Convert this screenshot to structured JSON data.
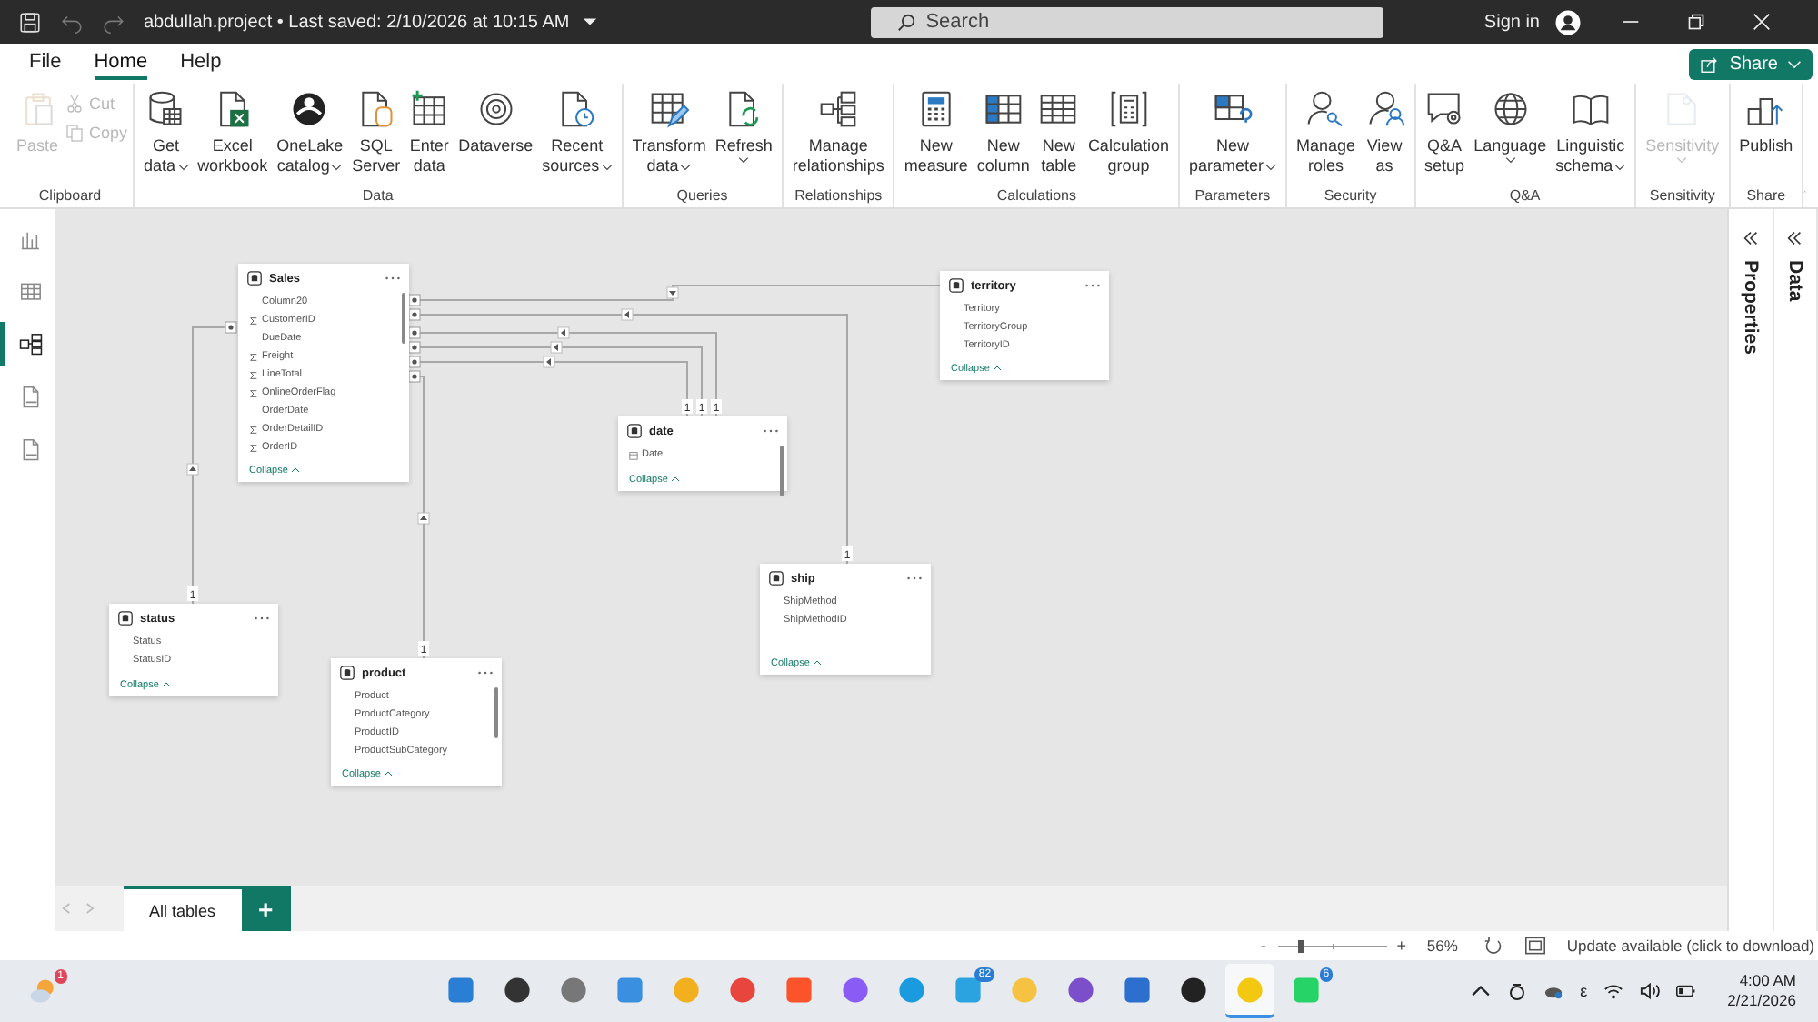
{
  "title_bar": {
    "title": "abdullah.project • Last saved: 2/10/2026 at 10:15 AM",
    "search": {
      "placeholder": "Search"
    },
    "sign_in": "Sign in"
  },
  "menu_tabs": [
    {
      "label": "File",
      "selected": false
    },
    {
      "label": "Home",
      "selected": true
    },
    {
      "label": "Help",
      "selected": false
    }
  ],
  "share_button": "Share",
  "ribbon_groups": [
    {
      "label": "Clipboard",
      "buttons": [
        {
          "kind": "large",
          "lines": [
            "Paste"
          ],
          "disabled": true,
          "dropdown": false
        },
        {
          "kind": "small",
          "lines": [
            "Cut"
          ],
          "disabled": true
        },
        {
          "kind": "small",
          "lines": [
            "Copy"
          ],
          "disabled": true
        }
      ]
    },
    {
      "label": "Data",
      "buttons": [
        {
          "kind": "large",
          "lines": [
            "Get",
            "data"
          ],
          "disabled": false,
          "dropdown": true
        },
        {
          "kind": "large",
          "lines": [
            "Excel",
            "workbook"
          ],
          "disabled": false,
          "dropdown": false
        },
        {
          "kind": "large",
          "lines": [
            "OneLake",
            "catalog"
          ],
          "disabled": false,
          "dropdown": true
        },
        {
          "kind": "large",
          "lines": [
            "SQL",
            "Server"
          ],
          "disabled": false,
          "dropdown": false
        },
        {
          "kind": "large",
          "lines": [
            "Enter",
            "data"
          ],
          "disabled": false,
          "dropdown": false
        },
        {
          "kind": "large",
          "lines": [
            "Dataverse"
          ],
          "disabled": false,
          "dropdown": false
        },
        {
          "kind": "large",
          "lines": [
            "Recent",
            "sources"
          ],
          "disabled": false,
          "dropdown": true
        }
      ]
    },
    {
      "label": "Queries",
      "buttons": [
        {
          "kind": "large",
          "lines": [
            "Transform",
            "data"
          ],
          "disabled": false,
          "dropdown": true
        },
        {
          "kind": "large",
          "lines": [
            "Refresh"
          ],
          "disabled": false,
          "dropdown": true
        }
      ]
    },
    {
      "label": "Relationships",
      "buttons": [
        {
          "kind": "large",
          "lines": [
            "Manage",
            "relationships"
          ],
          "disabled": false,
          "dropdown": false
        }
      ]
    },
    {
      "label": "Calculations",
      "buttons": [
        {
          "kind": "large",
          "lines": [
            "New",
            "measure"
          ],
          "disabled": false,
          "dropdown": false
        },
        {
          "kind": "large",
          "lines": [
            "New",
            "column"
          ],
          "disabled": false,
          "dropdown": false
        },
        {
          "kind": "large",
          "lines": [
            "New",
            "table"
          ],
          "disabled": false,
          "dropdown": false
        },
        {
          "kind": "large",
          "lines": [
            "Calculation",
            "group"
          ],
          "disabled": false,
          "dropdown": false
        }
      ]
    },
    {
      "label": "Parameters",
      "buttons": [
        {
          "kind": "large",
          "lines": [
            "New",
            "parameter"
          ],
          "disabled": false,
          "dropdown": true
        }
      ]
    },
    {
      "label": "Security",
      "buttons": [
        {
          "kind": "large",
          "lines": [
            "Manage",
            "roles"
          ],
          "disabled": false,
          "dropdown": false
        },
        {
          "kind": "large",
          "lines": [
            "View",
            "as"
          ],
          "disabled": false,
          "dropdown": false
        }
      ]
    },
    {
      "label": "Q&A",
      "buttons": [
        {
          "kind": "large",
          "lines": [
            "Q&A",
            "setup"
          ],
          "disabled": false,
          "dropdown": false
        },
        {
          "kind": "large",
          "lines": [
            "Language"
          ],
          "disabled": false,
          "dropdown": true
        },
        {
          "kind": "large",
          "lines": [
            "Linguistic",
            "schema"
          ],
          "disabled": false,
          "dropdown": true
        }
      ]
    },
    {
      "label": "Sensitivity",
      "buttons": [
        {
          "kind": "large",
          "lines": [
            "Sensitivity"
          ],
          "disabled": true,
          "dropdown": true
        }
      ]
    },
    {
      "label": "Share",
      "buttons": [
        {
          "kind": "large",
          "lines": [
            "Publish"
          ],
          "disabled": false,
          "dropdown": false
        }
      ]
    }
  ],
  "left_nav": [
    {
      "selected": false
    },
    {
      "selected": false
    },
    {
      "selected": true
    },
    {
      "selected": false
    },
    {
      "selected": false
    }
  ],
  "tables": [
    {
      "name": "Sales",
      "fields": [
        {
          "name": "Column20",
          "kind": "text"
        },
        {
          "name": "CustomerID",
          "kind": "numeric"
        },
        {
          "name": "DueDate",
          "kind": "text"
        },
        {
          "name": "Freight",
          "kind": "numeric"
        },
        {
          "name": "LineTotal",
          "kind": "numeric"
        },
        {
          "name": "OnlineOrderFlag",
          "kind": "numeric"
        },
        {
          "name": "OrderDate",
          "kind": "text"
        },
        {
          "name": "OrderDetailID",
          "kind": "numeric"
        },
        {
          "name": "OrderID",
          "kind": "numeric"
        }
      ],
      "collapse": "Collapse"
    },
    {
      "name": "territory",
      "fields": [
        {
          "name": "Territory",
          "kind": "text"
        },
        {
          "name": "TerritoryGroup",
          "kind": "text"
        },
        {
          "name": "TerritoryID",
          "kind": "text"
        }
      ],
      "collapse": "Collapse"
    },
    {
      "name": "date",
      "fields": [
        {
          "name": "Date",
          "kind": "date"
        }
      ],
      "collapse": "Collapse"
    },
    {
      "name": "status",
      "fields": [
        {
          "name": "Status",
          "kind": "text"
        },
        {
          "name": "StatusID",
          "kind": "text"
        }
      ],
      "collapse": "Collapse"
    },
    {
      "name": "product",
      "fields": [
        {
          "name": "Product",
          "kind": "text"
        },
        {
          "name": "ProductCategory",
          "kind": "text"
        },
        {
          "name": "ProductID",
          "kind": "text"
        },
        {
          "name": "ProductSubCategory",
          "kind": "text"
        }
      ],
      "collapse": "Collapse"
    },
    {
      "name": "ship",
      "fields": [
        {
          "name": "ShipMethod",
          "kind": "text"
        },
        {
          "name": "ShipMethodID",
          "kind": "text"
        }
      ],
      "collapse": "Collapse"
    }
  ],
  "relationships": [
    {
      "kind": "many-to-one"
    },
    {
      "kind": "many-to-one",
      "label": "1"
    },
    {
      "kind": "many-to-one",
      "label": "1"
    },
    {
      "kind": "many-to-one",
      "label": "1"
    },
    {
      "kind": "many-to-one",
      "label": "1"
    },
    {
      "kind": "many-to-one",
      "label": "1"
    },
    {
      "kind": "many-to-one",
      "label": "1"
    }
  ],
  "right_panes": [
    {
      "label": "Properties"
    },
    {
      "label": "Data"
    }
  ],
  "page_tabs": [
    {
      "label": "All tables",
      "selected": true
    }
  ],
  "add_page": "+",
  "status_bar": {
    "zoom": {
      "minus": "-",
      "plus": "+",
      "level": 0.2,
      "reading": "56%"
    },
    "update": "Update available (click to download)"
  },
  "taskbar": {
    "weather_badge": "1",
    "apps": [
      {
        "selected": false
      },
      {
        "selected": false
      },
      {
        "selected": false
      },
      {
        "selected": false
      },
      {
        "selected": false
      },
      {
        "selected": false
      },
      {
        "selected": false
      },
      {
        "selected": false
      },
      {
        "selected": false
      },
      {
        "selected": false,
        "badge": "82"
      },
      {
        "selected": false
      },
      {
        "selected": false
      },
      {
        "selected": false
      },
      {
        "selected": false
      },
      {
        "selected": true
      },
      {
        "selected": false,
        "badge": "6"
      }
    ],
    "tray_glyph": "ε",
    "time": "4:00 AM",
    "date": "2/21/2026"
  }
}
